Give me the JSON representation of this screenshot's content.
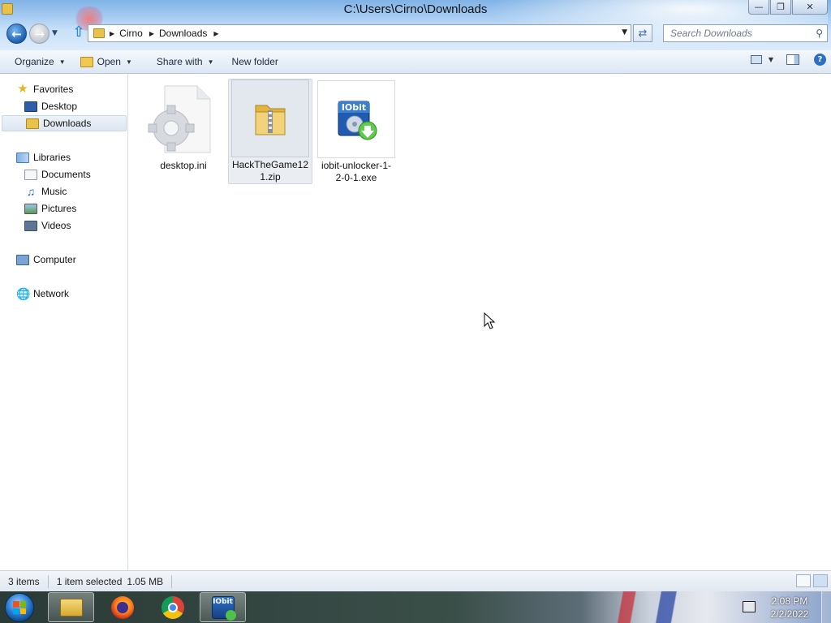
{
  "window": {
    "title": "C:\\Users\\Cirno\\Downloads",
    "controls": {
      "minimize": "—",
      "maximize": "❐",
      "close": "✕"
    }
  },
  "address": {
    "crumbs": [
      "Cirno",
      "Downloads"
    ],
    "search_placeholder": "Search Downloads"
  },
  "toolbar": {
    "organize": "Organize",
    "open": "Open",
    "share_with": "Share with",
    "new_folder": "New folder"
  },
  "nav": {
    "favorites": "Favorites",
    "desktop": "Desktop",
    "downloads": "Downloads",
    "libraries": "Libraries",
    "documents": "Documents",
    "music": "Music",
    "pictures": "Pictures",
    "videos": "Videos",
    "computer": "Computer",
    "network": "Network"
  },
  "files": [
    {
      "name": "desktop.ini",
      "icon": "settings-file-icon"
    },
    {
      "name": "HackTheGame121.zip",
      "icon": "zip-folder-icon",
      "selected": true
    },
    {
      "name": "iobit-unlocker-1-2-0-1.exe",
      "icon": "iobit-installer-icon"
    }
  ],
  "file_labels": {
    "f0": "desktop.ini",
    "f1a": "HackTheGame12",
    "f1b": "1.zip",
    "f2a": "iobit-unlocker-1-",
    "f2b": "2-0-1.exe",
    "iobit_logo": "IObit"
  },
  "status": {
    "item_count": "3 items",
    "selection": "1 item selected",
    "size": "1.05 MB"
  },
  "taskbar": {
    "iobit_label": "IObit",
    "time": "2:08 PM",
    "date": "2/2/2022"
  },
  "colors": {
    "accent": "#1a5fb0",
    "folder": "#e9c349"
  }
}
